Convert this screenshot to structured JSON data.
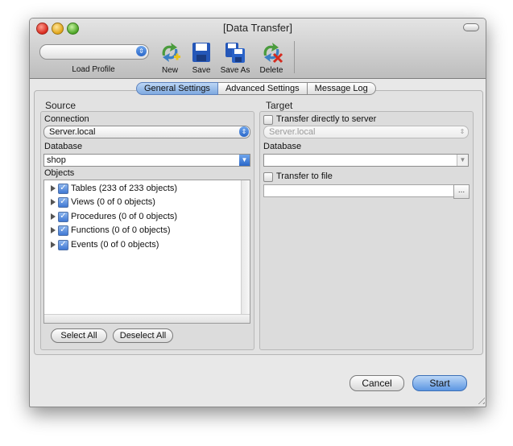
{
  "window": {
    "title": "[Data Transfer]"
  },
  "toolbar": {
    "load_profile_label": "Load Profile",
    "new_label": "New",
    "save_label": "Save",
    "save_as_label": "Save As",
    "delete_label": "Delete"
  },
  "tabs": [
    {
      "label": "General Settings",
      "active": true
    },
    {
      "label": "Advanced Settings",
      "active": false
    },
    {
      "label": "Message Log",
      "active": false
    }
  ],
  "source": {
    "title": "Source",
    "connection_label": "Connection",
    "connection_value": "Server.local",
    "database_label": "Database",
    "database_value": "shop",
    "objects_label": "Objects",
    "objects": [
      {
        "label": "Tables (233 of 233 objects)",
        "checked": true
      },
      {
        "label": "Views (0 of 0 objects)",
        "checked": true
      },
      {
        "label": "Procedures (0 of 0 objects)",
        "checked": true
      },
      {
        "label": "Functions (0 of 0 objects)",
        "checked": true
      },
      {
        "label": "Events (0 of 0 objects)",
        "checked": true
      }
    ],
    "select_all_label": "Select All",
    "deselect_all_label": "Deselect All"
  },
  "target": {
    "title": "Target",
    "transfer_server_label": "Transfer directly to server",
    "server_value": "Server.local",
    "database_label": "Database",
    "database_value": "",
    "transfer_file_label": "Transfer to file",
    "file_value": "",
    "browse_label": "..."
  },
  "buttons": {
    "cancel_label": "Cancel",
    "start_label": "Start"
  },
  "colors": {
    "accent": "#4a86dc",
    "window_bg": "#e8e8e8"
  }
}
